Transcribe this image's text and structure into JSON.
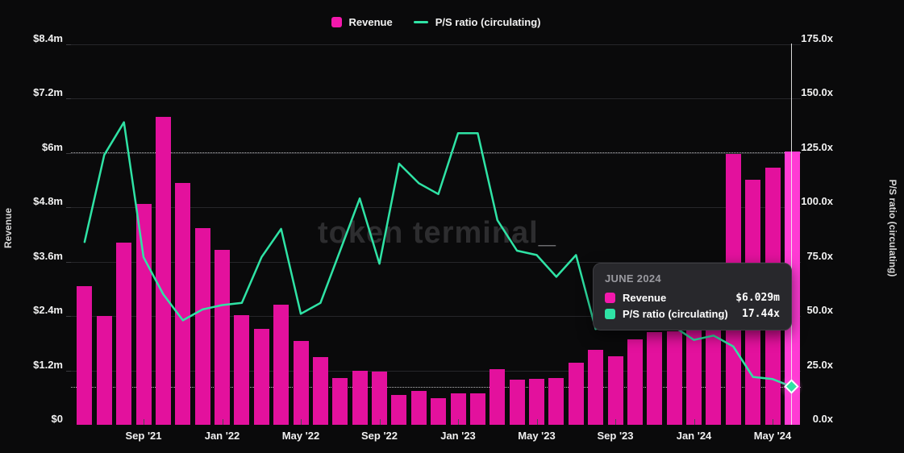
{
  "legend": {
    "items": [
      {
        "label": "Revenue",
        "swatch": "square",
        "color": "#f318ac"
      },
      {
        "label": "P/S ratio (circulating)",
        "swatch": "line",
        "color": "#2fe3a5"
      }
    ]
  },
  "watermark": "token terminal_",
  "axes": {
    "left_title": "Revenue",
    "right_title": "P/S ratio (circulating)",
    "left_ticks": [
      "$8.4m",
      "$7.2m",
      "$6m",
      "$4.8m",
      "$3.6m",
      "$2.4m",
      "$1.2m",
      "$0"
    ],
    "right_ticks": [
      "175.0x",
      "150.0x",
      "125.0x",
      "100.0x",
      "75.0x",
      "50.0x",
      "25.0x",
      "0.0x"
    ],
    "x_ticks": [
      "Sep '21",
      "Jan '22",
      "May '22",
      "Sep '22",
      "Jan '23",
      "May '23",
      "Sep '23",
      "Jan '24",
      "May '24"
    ]
  },
  "tooltip": {
    "title": "JUNE 2024",
    "rows": [
      {
        "label": "Revenue",
        "value": "$6.029m",
        "color": "#f318ac"
      },
      {
        "label": "P/S ratio (circulating)",
        "value": "17.44x",
        "color": "#2fe3a5"
      }
    ]
  },
  "colors": {
    "background": "#0a0a0b",
    "bar": "#e3119d",
    "bar_highlight": "#ff3bd4",
    "line": "#2fe3a5",
    "gridline": "#26262a",
    "crosshair": "#e8e8e8",
    "tooltip_bg": "#28282c"
  },
  "chart_data": {
    "type": "bar",
    "subtype": "combo bar+line, dual axis",
    "categories": [
      "Jun '21",
      "Jul '21",
      "Aug '21",
      "Sep '21",
      "Oct '21",
      "Nov '21",
      "Dec '21",
      "Jan '22",
      "Feb '22",
      "Mar '22",
      "Apr '22",
      "May '22",
      "Jun '22",
      "Jul '22",
      "Aug '22",
      "Sep '22",
      "Oct '22",
      "Nov '22",
      "Dec '22",
      "Jan '23",
      "Feb '23",
      "Mar '23",
      "Apr '23",
      "May '23",
      "Jun '23",
      "Jul '23",
      "Aug '23",
      "Sep '23",
      "Oct '23",
      "Nov '23",
      "Dec '23",
      "Jan '24",
      "Feb '24",
      "Mar '24",
      "Apr '24",
      "May '24",
      "Jun '24"
    ],
    "series": [
      {
        "name": "Revenue",
        "type": "bar",
        "axis": "left",
        "unit": "$m",
        "values": [
          3.05,
          2.4,
          4.02,
          4.88,
          6.79,
          5.34,
          4.33,
          3.86,
          2.42,
          2.12,
          2.65,
          1.85,
          1.5,
          1.03,
          1.19,
          1.17,
          0.66,
          0.75,
          0.58,
          0.69,
          0.7,
          1.23,
          1.0,
          1.01,
          1.03,
          1.37,
          1.65,
          1.52,
          1.88,
          2.05,
          2.07,
          2.08,
          2.08,
          5.98,
          5.41,
          5.67,
          6.029
        ]
      },
      {
        "name": "P/S ratio (circulating)",
        "type": "line",
        "axis": "right",
        "unit": "x",
        "values": [
          84,
          124,
          139,
          77,
          60,
          48,
          53,
          55,
          56,
          77,
          90,
          51,
          56,
          80,
          104,
          74,
          120,
          111,
          106,
          134,
          134,
          94,
          80,
          78,
          68,
          78,
          44,
          46,
          48,
          47,
          45,
          39,
          41,
          36,
          22,
          21,
          17.44
        ]
      }
    ],
    "left_axis": {
      "label": "Revenue",
      "range": [
        0,
        8.4
      ],
      "tick_step": 1.2,
      "unit": "$m"
    },
    "right_axis": {
      "label": "P/S ratio (circulating)",
      "range": [
        0,
        175
      ],
      "tick_step": 25,
      "unit": "x"
    },
    "grid": true,
    "legend_position": "top-center",
    "highlighted_category": "Jun '24",
    "highlight_values": {
      "revenue": "$6.029m",
      "ps_ratio": "17.44x"
    }
  }
}
